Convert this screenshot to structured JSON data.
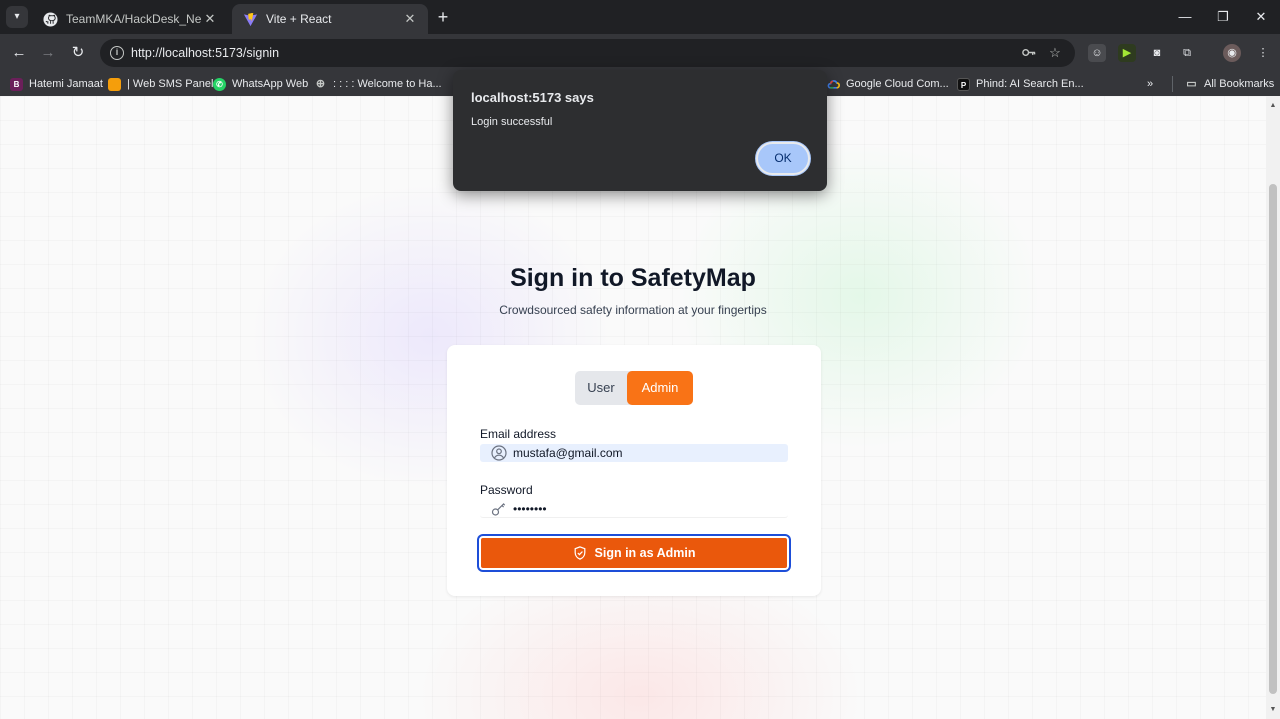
{
  "browser": {
    "tabs": [
      {
        "title": "TeamMKA/HackDesk_Nerd.js: A",
        "active": false
      },
      {
        "title": "Vite + React",
        "active": true
      }
    ],
    "url": "http://localhost:5173/signin",
    "bookmarks": [
      {
        "label": "Hatemi Jamaat",
        "icon": "B"
      },
      {
        "label": "| Web SMS Panel",
        "icon": ""
      },
      {
        "label": "WhatsApp Web",
        "icon": "whatsapp-icon"
      },
      {
        "label": ": : : : Welcome to Ha...",
        "icon": "globe-icon"
      },
      {
        "label": "Google Cloud Com...",
        "icon": "google-cloud-icon"
      },
      {
        "label": "Phind: AI Search En...",
        "icon": "P"
      }
    ],
    "bookmarks_overflow": "»",
    "all_bookmarks": "All Bookmarks"
  },
  "page": {
    "title": "Sign in to SafetyMap",
    "subtitle": "Crowdsourced safety information at your fingertips",
    "roles": {
      "user": "User",
      "admin": "Admin",
      "selected": "Admin"
    },
    "email": {
      "label": "Email address",
      "value": "mustafa@gmail.com"
    },
    "password": {
      "label": "Password",
      "value": "••••••••"
    },
    "submit_label": "Sign in as Admin",
    "accent_color": "#ea580c"
  },
  "dialog": {
    "title": "localhost:5173 says",
    "message": "Login successful",
    "ok_label": "OK"
  }
}
